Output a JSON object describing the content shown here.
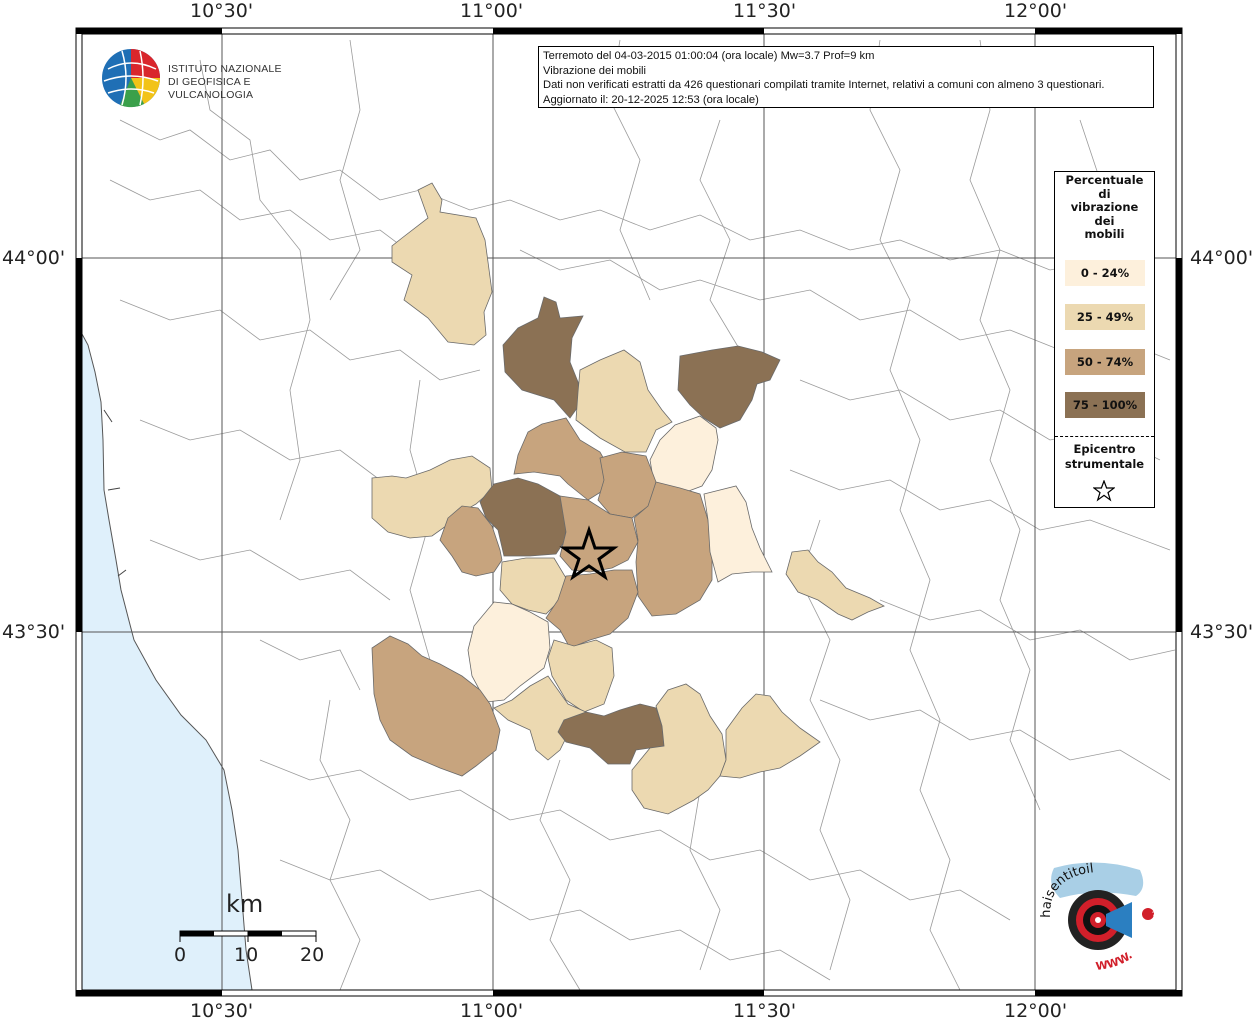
{
  "info": {
    "line1": "Terremoto del 04-03-2015 01:00:04 (ora locale) Mw=3.7 Prof=9 km",
    "line2": "Vibrazione dei mobili",
    "line3": "Dati non verificati estratti da 426 questionari compilati tramite Internet, relativi a comuni con almeno 3 questionari.",
    "line4": "Aggiornato il: 20-12-2025 12:53 (ora locale)"
  },
  "institute": {
    "line1": "ISTITUTO NAZIONALE",
    "line2": "DI GEOFISICA E VULCANOLOGIA"
  },
  "axes": {
    "top": [
      "10°30'",
      "11°00'",
      "11°30'",
      "12°00'"
    ],
    "bottom": [
      "10°30'",
      "11°00'",
      "11°30'",
      "12°00'"
    ],
    "left": [
      "44°00'",
      "43°30'"
    ],
    "right": [
      "44°00'",
      "43°30'"
    ]
  },
  "legend": {
    "title": [
      "Percentuale",
      "di",
      "vibrazione",
      "dei",
      "mobili"
    ],
    "classes": [
      {
        "label": "0 - 24%",
        "color": "#fdf0dc"
      },
      {
        "label": "25 - 49%",
        "color": "#ecd9b1"
      },
      {
        "label": "50 - 74%",
        "color": "#c7a47e"
      },
      {
        "label": "75 - 100%",
        "color": "#8b7154"
      }
    ],
    "epicenter_title": [
      "Epicentro",
      "strumentale"
    ],
    "epicenter_icon": "star-icon"
  },
  "scale": {
    "unit": "km",
    "ticks": [
      "0",
      "10",
      "20"
    ]
  },
  "colors": {
    "sea": "#dff0fb",
    "border": "#000000",
    "grid": "#555555"
  },
  "footer_logo": {
    "text": "haisentitoilterremoto.it",
    "url_text": "WWW.",
    "icon": "target-megaphone-icon"
  }
}
